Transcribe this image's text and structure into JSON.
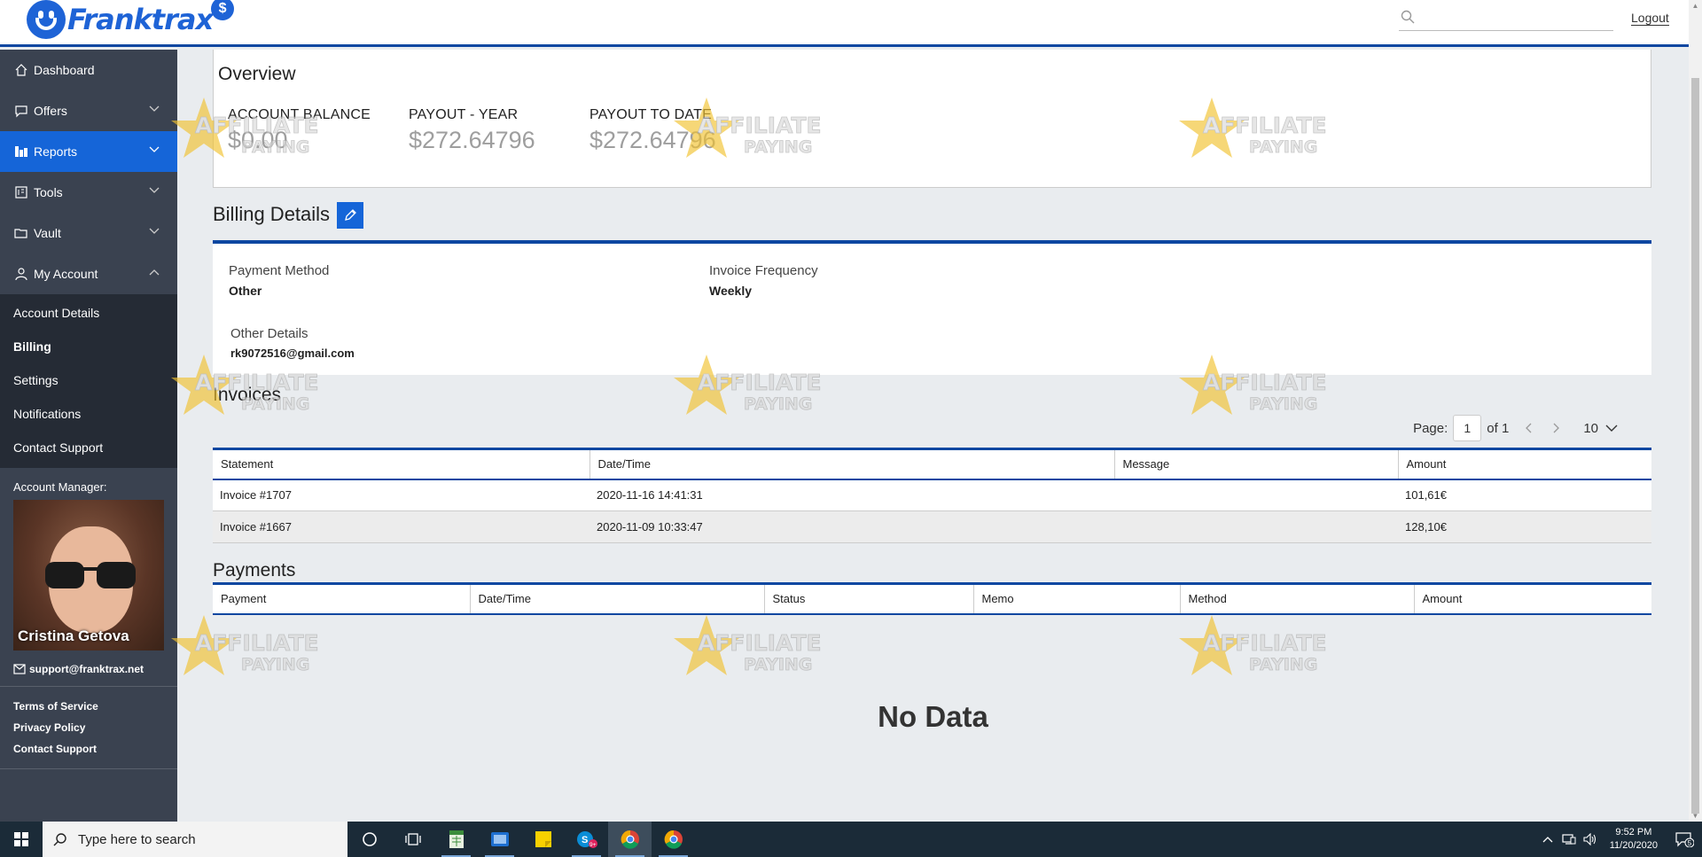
{
  "app": {
    "brand": "Franktrax",
    "brand_badge": "$"
  },
  "topbar": {
    "search_placeholder": "",
    "logout_label": "Logout"
  },
  "sidebar": {
    "items": [
      {
        "label": "Dashboard",
        "icon": "home-icon"
      },
      {
        "label": "Offers",
        "icon": "chat-icon"
      },
      {
        "label": "Reports",
        "icon": "bar-chart-icon"
      },
      {
        "label": "Tools",
        "icon": "tools-icon"
      },
      {
        "label": "Vault",
        "icon": "folder-icon"
      },
      {
        "label": "My Account",
        "icon": "user-icon"
      }
    ],
    "sub_items": [
      "Account Details",
      "Billing",
      "Settings",
      "Notifications",
      "Contact Support"
    ],
    "account_manager_label": "Account Manager:",
    "account_manager_name": "Cristina Getova",
    "support_email": "support@franktrax.net",
    "legal": [
      "Terms of Service",
      "Privacy Policy",
      "Contact Support"
    ]
  },
  "overview": {
    "title": "Overview",
    "stats": [
      {
        "label": "ACCOUNT BALANCE",
        "value": "$0.00"
      },
      {
        "label": "PAYOUT - YEAR",
        "value": "$272.64796"
      },
      {
        "label": "PAYOUT TO DATE",
        "value": "$272.64796"
      }
    ]
  },
  "billing": {
    "title": "Billing Details",
    "payment_method_label": "Payment Method",
    "payment_method_value": "Other",
    "invoice_frequency_label": "Invoice Frequency",
    "invoice_frequency_value": "Weekly",
    "other_details_label": "Other Details",
    "other_details_value": "rk9072516@gmail.com"
  },
  "invoices": {
    "title": "Invoices",
    "pager": {
      "page_label": "Page:",
      "page": "1",
      "of_label": "of 1",
      "per_page": "10"
    },
    "columns": [
      "Statement",
      "Date/Time",
      "Message",
      "Amount"
    ],
    "rows": [
      [
        "Invoice #1707",
        "2020-11-16 14:41:31",
        "",
        "101,61€"
      ],
      [
        "Invoice #1667",
        "2020-11-09 10:33:47",
        "",
        "128,10€"
      ]
    ]
  },
  "payments": {
    "title": "Payments",
    "columns": [
      "Payment",
      "Date/Time",
      "Status",
      "Memo",
      "Method",
      "Amount"
    ],
    "empty_text": "No Data"
  },
  "watermark": {
    "line1": "AFFILIATE",
    "line2": "PAYING"
  },
  "taskbar": {
    "search_placeholder": "Type here to search",
    "time": "9:52 PM",
    "date": "11/20/2020",
    "skype_badge": "9+",
    "notif_count": "5"
  },
  "colors": {
    "primary": "#1565d8",
    "accent_dark": "#0d47a1",
    "sidebar": "#3a4250",
    "sidebar_sub": "#252b35"
  }
}
